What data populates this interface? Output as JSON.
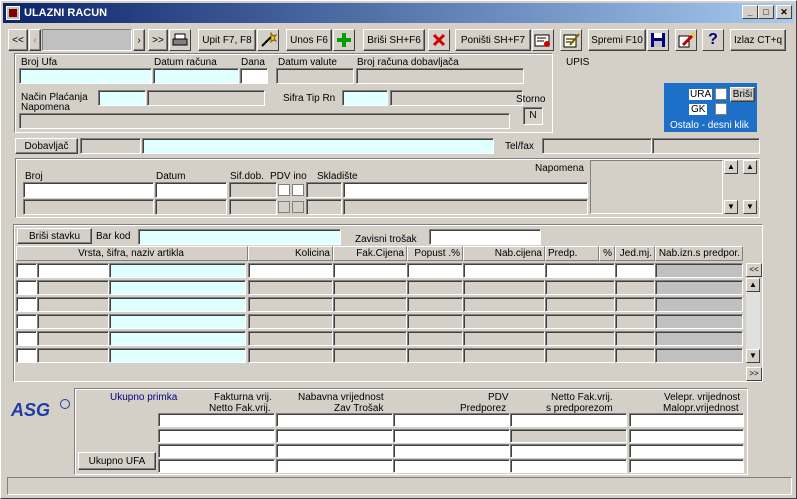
{
  "window": {
    "title": "ULAZNI RACUN",
    "min": "_",
    "max": "□",
    "close": "✕"
  },
  "toolbar": {
    "first": "<<",
    "prev": "‹",
    "next": "›",
    "last": ">>",
    "query": "Upit F7, F8",
    "insert": "Unos F6",
    "delete": "Briši  SH+F6",
    "cancel": "Poništi SH+F7",
    "save": "Spremi F10",
    "exit": "Izlaz CT+q",
    "help": "?"
  },
  "header": {
    "broj_ufa": "Broj Ufa",
    "datum_racuna": "Datum računa",
    "dana": "Dana",
    "datum_valute": "Datum valute",
    "broj_racuna_dobavljaca": "Broj računa dobavljača",
    "nacin_placanja": "Način Plaćanja",
    "sifra_tip_rn": "Sifra Tip Rn",
    "napomena": "Napomena",
    "storno": "Storno",
    "storno_value": "N",
    "upis": "UPIS"
  },
  "ura": {
    "ura": "URA",
    "gk": "GK",
    "brisi": "Briši",
    "ostalo": "Ostalo - desni  klik"
  },
  "dobavljac": {
    "button": "Dobavljač",
    "telfax": "Tel/fax"
  },
  "receipt": {
    "broj": "Broj",
    "datum": "Datum",
    "sifdob": "Sif.dob.",
    "pdv_ino": "PDV ino",
    "skladiste": "Skladište",
    "napomena": "Napomena"
  },
  "items": {
    "brisi_stavku": "Briši stavku",
    "bar_kod": "Bar kod",
    "zavisni_trosak": "Zavisni trošak",
    "columns": [
      "Vrsta, šifra, naziv artikla",
      "Kolicina",
      "Fak.Cijena",
      "Popust .%",
      "Nab.cijena",
      "Predp.",
      "%",
      "Jed.mj.",
      "Nab.izn.s predpor."
    ],
    "scroll_left": "<<",
    "scroll_right": ">>"
  },
  "totals": {
    "logo": "ASG",
    "ukupno_primka": "Ukupno primka",
    "fakturna": "Fakturna vrij.",
    "netto_fak": "Netto Fak.vrij.",
    "nabavna": "Nabavna vrijednost",
    "zav_trosak": "Zav Trošak",
    "pdv": "PDV",
    "predporez": "Predporez",
    "netto_sp": "Netto Fak.vrij.",
    "s_predporezom": "s predporezom",
    "velepr": "Velepr. vrijednost",
    "malopr": "Malopr.vrijednost",
    "ukupno_ufa": "Ukupno UFA"
  }
}
